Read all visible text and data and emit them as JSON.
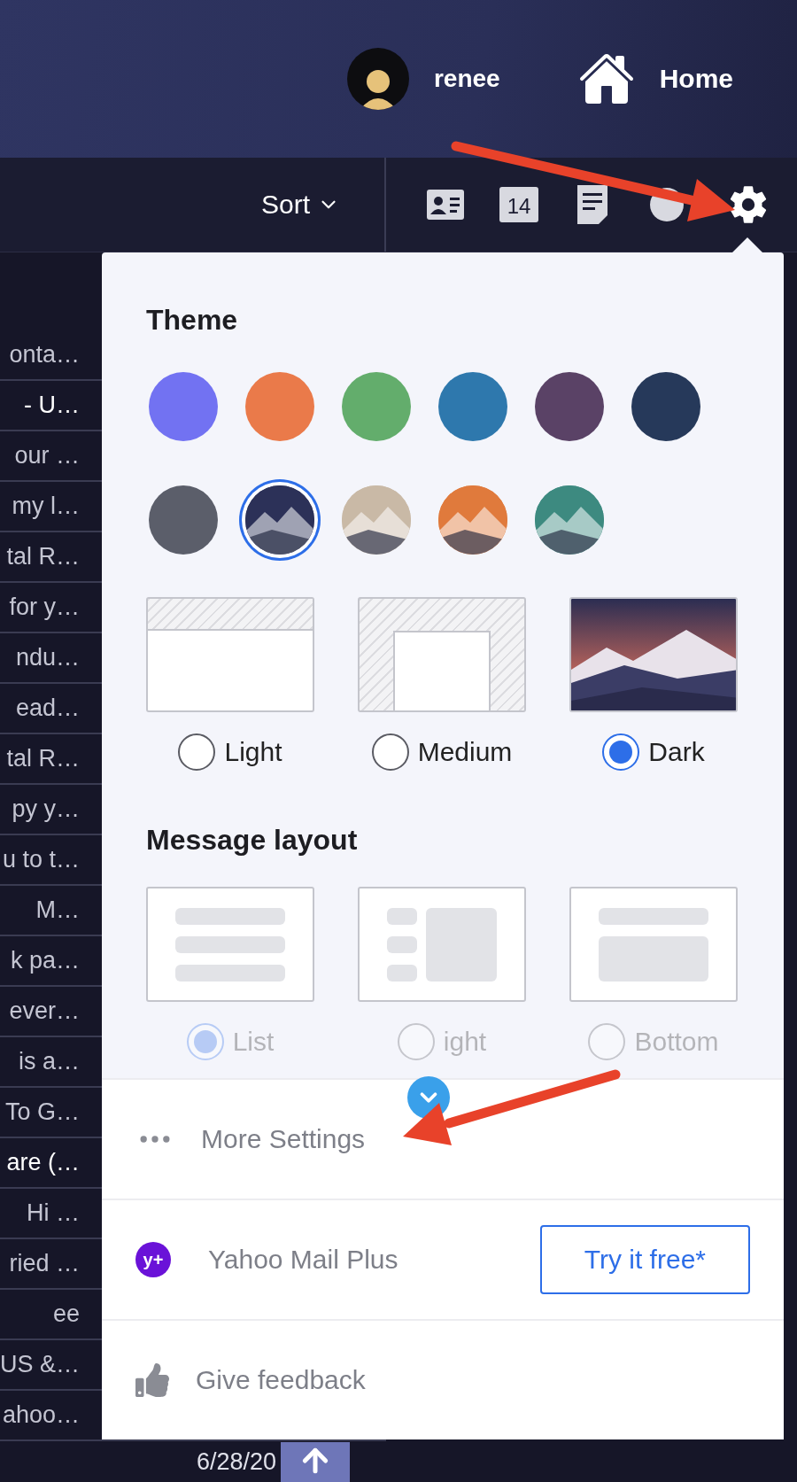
{
  "header": {
    "user": {
      "name": "renee"
    },
    "home": {
      "label": "Home"
    }
  },
  "toolbar": {
    "sort": "Sort",
    "calendar_day": "14"
  },
  "messages": [
    {
      "snippet": "onta…",
      "unread": false
    },
    {
      "snippet": "- U…",
      "unread": true
    },
    {
      "snippet": "our …",
      "unread": false
    },
    {
      "snippet": "my l…",
      "unread": false
    },
    {
      "snippet": "tal R…",
      "unread": false
    },
    {
      "snippet": "for y…",
      "unread": false
    },
    {
      "snippet": "ndu…",
      "unread": false
    },
    {
      "snippet": "ead…",
      "unread": false
    },
    {
      "snippet": "tal R…",
      "unread": false
    },
    {
      "snippet": "py y…",
      "unread": false
    },
    {
      "snippet": "u to t…",
      "unread": false
    },
    {
      "snippet": "M…",
      "unread": false
    },
    {
      "snippet": "k pa…",
      "unread": false
    },
    {
      "snippet": "ever…",
      "unread": false
    },
    {
      "snippet": "is a…",
      "unread": false
    },
    {
      "snippet": "To G…",
      "unread": false
    },
    {
      "snippet": "are (…",
      "unread": true
    },
    {
      "snippet": "Hi …",
      "unread": false
    },
    {
      "snippet": "ried …",
      "unread": false
    },
    {
      "snippet": "ee",
      "unread": false
    },
    {
      "snippet": "US &…",
      "unread": false
    },
    {
      "snippet": "ahoo…",
      "unread": false
    }
  ],
  "last_row": {
    "date": "6/28/20"
  },
  "settings": {
    "theme_title": "Theme",
    "themes": [
      {
        "kind": "color",
        "color": "#7272f2",
        "selected": false
      },
      {
        "kind": "color",
        "color": "#ea7a4a",
        "selected": false
      },
      {
        "kind": "color",
        "color": "#63ad6c",
        "selected": false
      },
      {
        "kind": "color",
        "color": "#2e78ad",
        "selected": false
      },
      {
        "kind": "color",
        "color": "#5a4266",
        "selected": false
      },
      {
        "kind": "color",
        "color": "#26395a",
        "selected": false
      },
      {
        "kind": "color",
        "color": "#5b5e6a",
        "selected": false
      },
      {
        "kind": "scene",
        "color": "#2c3158",
        "selected": true
      },
      {
        "kind": "scene",
        "color": "#c9b9a6",
        "selected": false
      },
      {
        "kind": "scene",
        "color": "#e07a3c",
        "selected": false
      },
      {
        "kind": "scene",
        "color": "#3d8a80",
        "selected": false
      }
    ],
    "modes": [
      {
        "kind": "light",
        "label": "Light",
        "selected": false
      },
      {
        "kind": "medium",
        "label": "Medium",
        "selected": false
      },
      {
        "kind": "dark",
        "label": "Dark",
        "selected": true
      }
    ],
    "layout_title": "Message layout",
    "layouts": [
      {
        "kind": "list",
        "label": "List",
        "selected": true
      },
      {
        "kind": "right",
        "label": "ight",
        "selected": false
      },
      {
        "kind": "bottom",
        "label": "Bottom",
        "selected": false
      }
    ],
    "more_settings": "More Settings",
    "plus": {
      "badge": "y+",
      "label": "Yahoo Mail Plus",
      "button": "Try it free*"
    },
    "feedback": "Give feedback"
  }
}
